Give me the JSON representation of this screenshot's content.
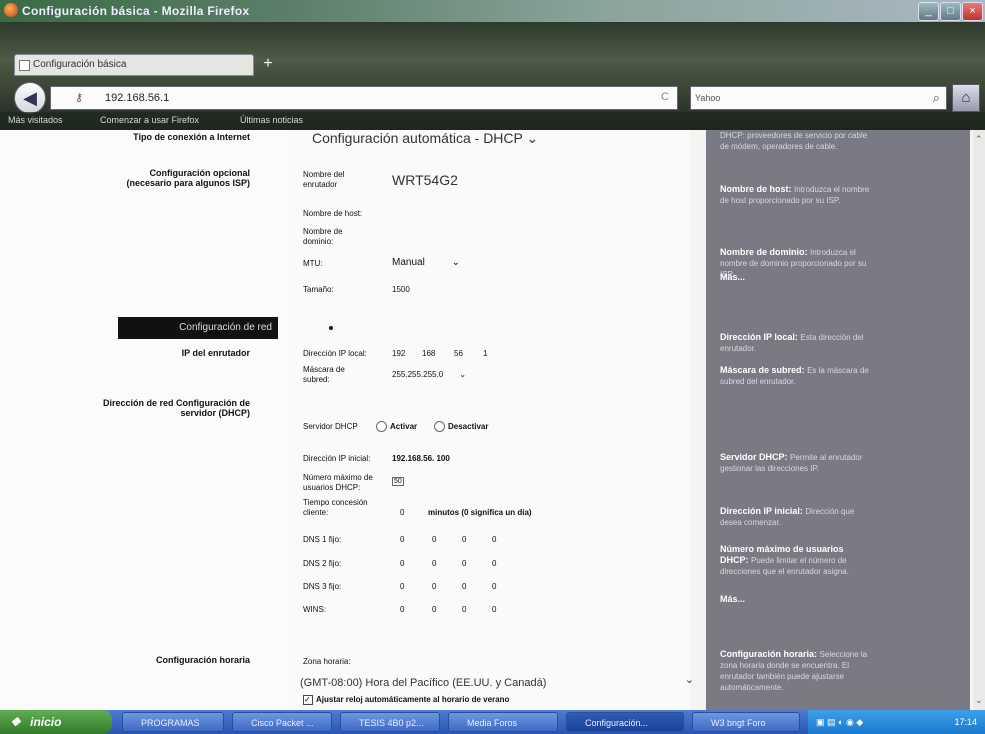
{
  "window": {
    "title": "Configuración básica - Mozilla Firefox"
  },
  "browser": {
    "tab_label": "Configuración básica",
    "url": "192.168.56.1",
    "search_engine": "Yahoo",
    "bookmarks": [
      "Más visitados",
      "Comenzar a usar Firefox",
      "Últimas noticias"
    ]
  },
  "form": {
    "connection_type_label": "Tipo de conexión a Internet",
    "connection_type_value": "Configuración automática - DHCP",
    "optional_section_label": "Configuración opcional (necesario para algunos ISP)",
    "router_name_label": "Nombre del enrutador",
    "router_name_value": "WRT54G2",
    "host_name_label": "Nombre de host:",
    "domain_name_label": "Nombre de dominio:",
    "mtu_label": "MTU:",
    "mtu_value": "Manual",
    "size_label": "Tamaño:",
    "size_value": "1500",
    "network_tab_label": "Configuración de red",
    "router_ip_section_label": "IP del enrutador",
    "local_ip_label": "Dirección IP local:",
    "local_ip": [
      "192",
      "168",
      "56",
      "1"
    ],
    "subnet_label": "Máscara de subred:",
    "subnet_value": "255.255.255.0",
    "dhcp_section_label": "Dirección de red Configuración de servidor (DHCP)",
    "dhcp_server_label": "Servidor DHCP",
    "enable_label": "Activar",
    "disable_label": "Desactivar",
    "start_ip_label": "Dirección IP inicial:",
    "start_ip_value": "192.168.56. 100",
    "max_users_label": "Número máximo de usuarios DHCP:",
    "max_users_value": "50",
    "lease_label": "Tiempo concesión cliente:",
    "lease_value": "0",
    "lease_suffix": "minutos (0 significa un día)",
    "dns1_label": "DNS 1 fijo:",
    "dns2_label": "DNS 2 fijo:",
    "dns3_label": "DNS 3 fijo:",
    "wins_label": "WINS:",
    "zero": "0",
    "time_section_label": "Configuración horaria",
    "timezone_label": "Zona horaria:",
    "timezone_value": "(GMT-08:00) Hora del Pacífico (EE.UU. y Canadá)",
    "dst_label": "Ajustar reloj automáticamente al horario de verano"
  },
  "help": {
    "dhcp_tail": "DHCP: proveedores de servicio por cable de módem, operadores de cable.",
    "host_h": "Nombre de host:",
    "host_t": "Introduzca el nombre de host proporcionado por su ISP.",
    "domain_h": "Nombre de dominio:",
    "domain_t": "Introduzca el nombre de dominio proporcionado por su ISP.",
    "more": "Más...",
    "localip_h": "Dirección IP local:",
    "localip_t": "Esta dirección del enrutador.",
    "subnet_h": "Máscara de subred:",
    "subnet_t": "Es la máscara de subred del enrutador.",
    "dhcp_h": "Servidor DHCP:",
    "dhcp_t": "Permite al enrutador gestionar las direcciones IP.",
    "startip_h": "Dirección IP inicial:",
    "startip_t": "Dirección que desea comenzar.",
    "maxusers_h": "Número máximo de usuarios DHCP:",
    "maxusers_t": "Puede limitar el número de direcciones que el enrutador asigna.",
    "time_h": "Configuración horaria:",
    "time_t": "Seleccione la zona horaria donde se encuentra. El enrutador también puede ajustarse automáticamente."
  },
  "taskbar": {
    "start": "inicio",
    "items": [
      "PROGRAMAS",
      "Cisco Packet ...",
      "TESIS 4B0 p2...",
      "Media Foros",
      "Configuración...",
      "W3 bngt Foro"
    ],
    "clock": "17:14"
  }
}
